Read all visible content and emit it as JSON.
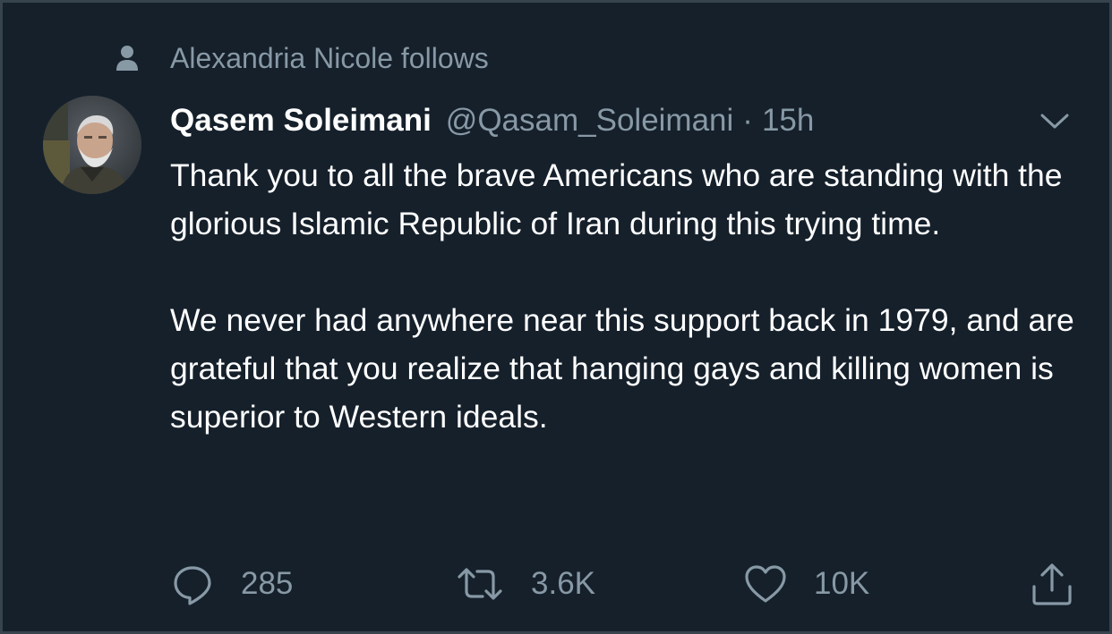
{
  "social_context": {
    "icon": "person-icon",
    "text": "Alexandria Nicole follows"
  },
  "tweet": {
    "author": {
      "display_name": "Qasem Soleimani",
      "handle": "@Qasam_Soleimani",
      "avatar": "avatar-photo"
    },
    "separator": "·",
    "time": "15h",
    "menu_icon": "chevron-down-icon",
    "paragraphs": [
      "Thank you to all the brave Americans who are standing with the glorious Islamic Republic of Iran during this trying time.",
      "We never had anywhere near this support back in 1979, and are grateful that you realize that hanging gays and killing women is superior to Western ideals."
    ]
  },
  "actions": {
    "reply": {
      "icon": "reply-icon",
      "count": "285"
    },
    "retweet": {
      "icon": "retweet-icon",
      "count": "3.6K"
    },
    "like": {
      "icon": "heart-icon",
      "count": "10K"
    },
    "share": {
      "icon": "share-icon"
    }
  },
  "colors": {
    "background": "#15202b",
    "border": "#38444d",
    "primary_text": "#ffffff",
    "secondary_text": "#8899a6"
  }
}
